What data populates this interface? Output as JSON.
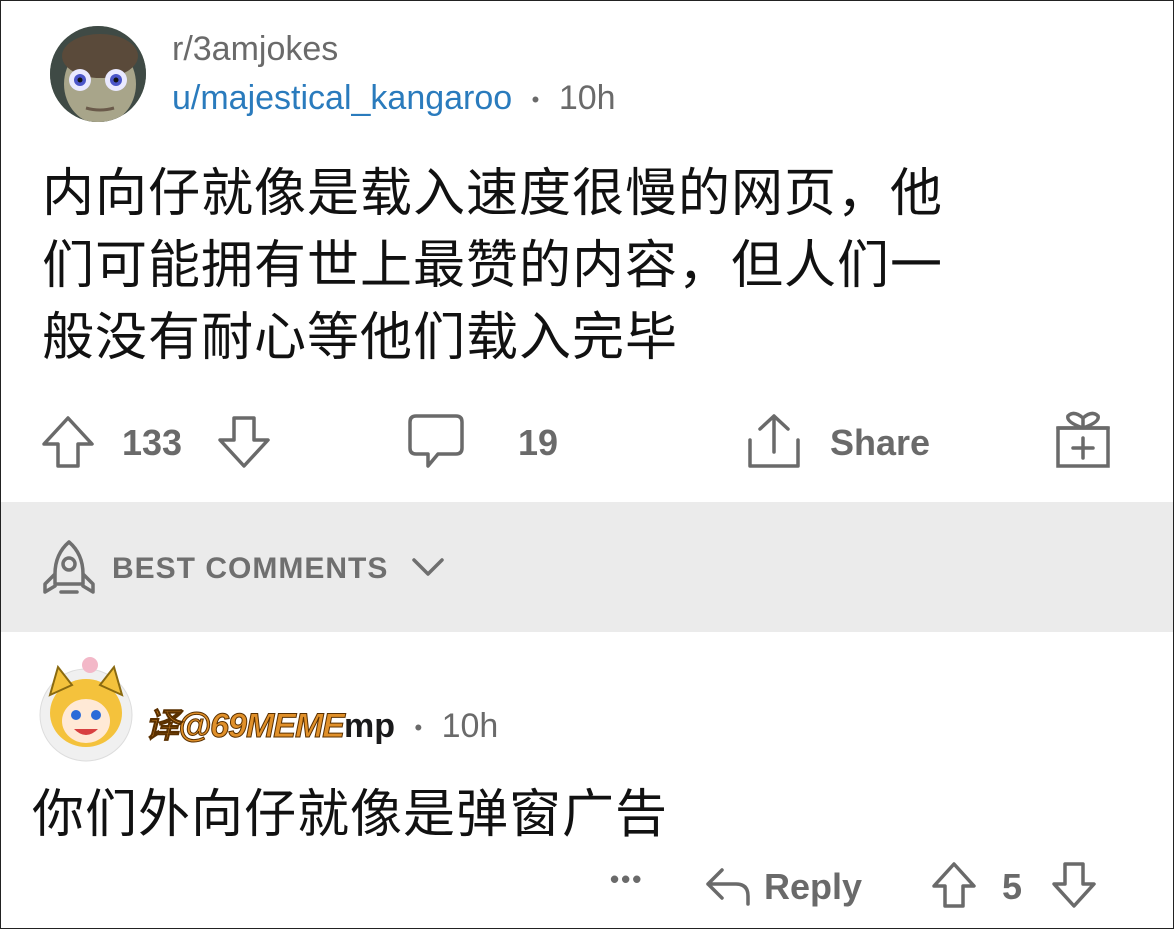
{
  "post": {
    "subreddit": "r/3amjokes",
    "author": "u/majestical_kangaroo",
    "separator": "•",
    "time": "10h",
    "title": "内向仔就像是载入速度很慢的网页，他们可能拥有世上最赞的内容，但人们一般没有耐心等他们载入完毕",
    "title_lines": [
      "内向仔就像是载入速度很慢的网页，他",
      "们可能拥有世上最赞的内容，但人们一",
      "般没有耐心等他们载入完毕"
    ],
    "upvotes": "133",
    "comments": "19",
    "share_label": "Share"
  },
  "sort": {
    "label": "BEST COMMENTS"
  },
  "comment": {
    "watermark": "译@69MEME",
    "author_suffix": "mp",
    "separator": "•",
    "time": "10h",
    "body": "你们外向仔就像是弹窗广告",
    "more": "•••",
    "reply_label": "Reply",
    "score": "5"
  },
  "icons": {
    "upvote": "arrow-up-icon",
    "downvote": "arrow-down-icon",
    "comment": "speech-bubble-icon",
    "share": "share-icon",
    "award": "gift-icon",
    "sort": "rocket-icon",
    "chevron": "chevron-down-icon",
    "reply": "reply-arrow-icon",
    "more": "more-dots-icon"
  },
  "colors": {
    "username": "#2a7bbd",
    "muted": "#6a6a6a",
    "divider_bg": "#ebebeb",
    "watermark": "#e0902a"
  }
}
